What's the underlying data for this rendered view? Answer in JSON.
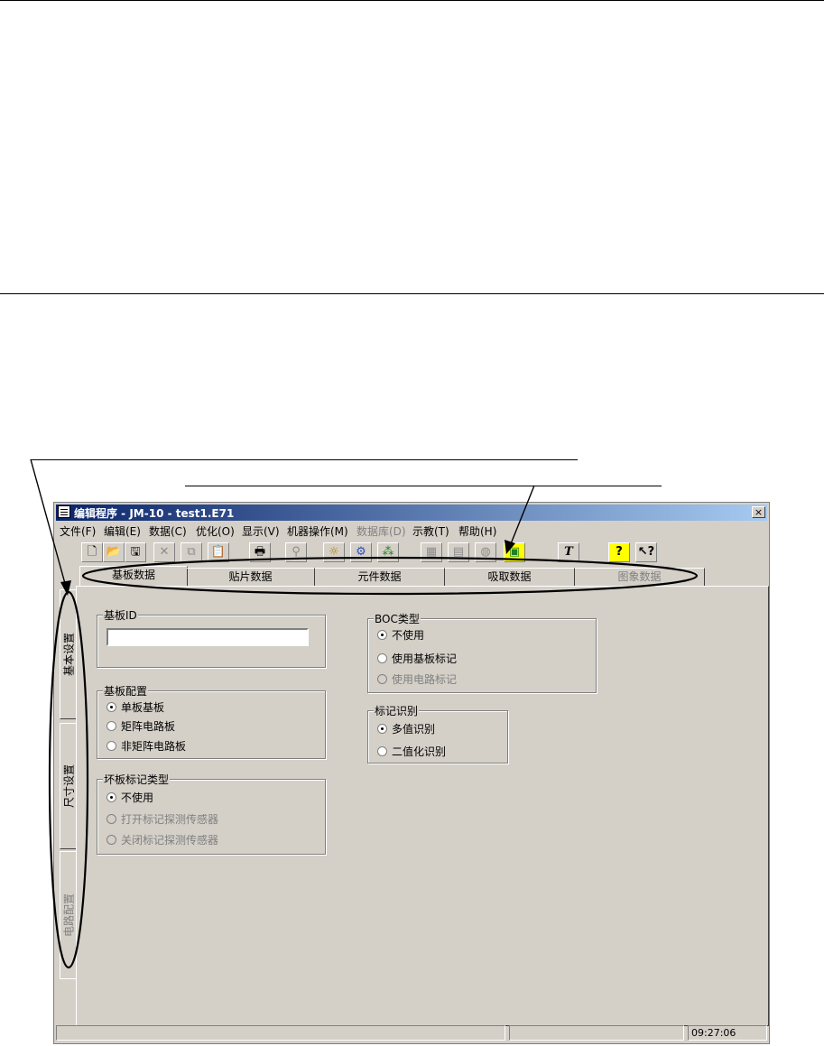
{
  "window": {
    "title": "编辑程序 - JM-10 - test1.E71",
    "close_label": "×"
  },
  "menu": [
    {
      "label": "文件(F)",
      "enabled": true
    },
    {
      "label": "编辑(E)",
      "enabled": true
    },
    {
      "label": "数据(C)",
      "enabled": true
    },
    {
      "label": "优化(O)",
      "enabled": true
    },
    {
      "label": "显示(V)",
      "enabled": true
    },
    {
      "label": "机器操作(M)",
      "enabled": true
    },
    {
      "label": "数据库(D)",
      "enabled": false
    },
    {
      "label": "示教(T)",
      "enabled": true
    },
    {
      "label": "帮助(H)",
      "enabled": true
    }
  ],
  "toolbar": {
    "new_glyph": "🗋",
    "open_glyph": "📂",
    "save_glyph": "🖫",
    "cut_glyph": "✕",
    "copy_glyph": "⧉",
    "paste_glyph": "📋",
    "print_glyph": "🖶",
    "find_glyph": "⚲",
    "optimize_glyph": "☼",
    "tool_glyph": "⚙",
    "parts_glyph": "⁂",
    "b1_glyph": "▦",
    "b2_glyph": "▤",
    "b3_glyph": "◍",
    "image_glyph": "▣",
    "text_glyph": "T",
    "help_glyph": "?",
    "context_help_glyph": "↖?"
  },
  "tabs": [
    {
      "label": "基板数据",
      "active": true,
      "enabled": true
    },
    {
      "label": "贴片数据",
      "active": false,
      "enabled": true
    },
    {
      "label": "元件数据",
      "active": false,
      "enabled": true
    },
    {
      "label": "吸取数据",
      "active": false,
      "enabled": true
    },
    {
      "label": "图象数据",
      "active": false,
      "enabled": false
    }
  ],
  "side_tabs": [
    {
      "label": "基本设置",
      "active": true,
      "enabled": true
    },
    {
      "label": "尺寸设置",
      "active": false,
      "enabled": true
    },
    {
      "label": "电路配置",
      "active": false,
      "enabled": false
    }
  ],
  "groups": {
    "board_id": {
      "title": "基板ID",
      "value": ""
    },
    "board_config": {
      "title": "基板配置",
      "options": [
        {
          "label": "单板基板",
          "selected": true,
          "enabled": true
        },
        {
          "label": "矩阵电路板",
          "selected": false,
          "enabled": true
        },
        {
          "label": "非矩阵电路板",
          "selected": false,
          "enabled": true
        }
      ]
    },
    "bad_mark": {
      "title": "坏板标记类型",
      "options": [
        {
          "label": "不使用",
          "selected": true,
          "enabled": true
        },
        {
          "label": "打开标记探测传感器",
          "selected": false,
          "enabled": false
        },
        {
          "label": "关闭标记探测传感器",
          "selected": false,
          "enabled": false
        }
      ]
    },
    "boc": {
      "title": "BOC类型",
      "options": [
        {
          "label": "不使用",
          "selected": true,
          "enabled": true
        },
        {
          "label": "使用基板标记",
          "selected": false,
          "enabled": true
        },
        {
          "label": "使用电路标记",
          "selected": false,
          "enabled": false
        }
      ]
    },
    "mark_recog": {
      "title": "标记识别",
      "options": [
        {
          "label": "多值识别",
          "selected": true,
          "enabled": true
        },
        {
          "label": "二值化识别",
          "selected": false,
          "enabled": true
        }
      ]
    }
  },
  "status": {
    "time": "09:27:06"
  }
}
